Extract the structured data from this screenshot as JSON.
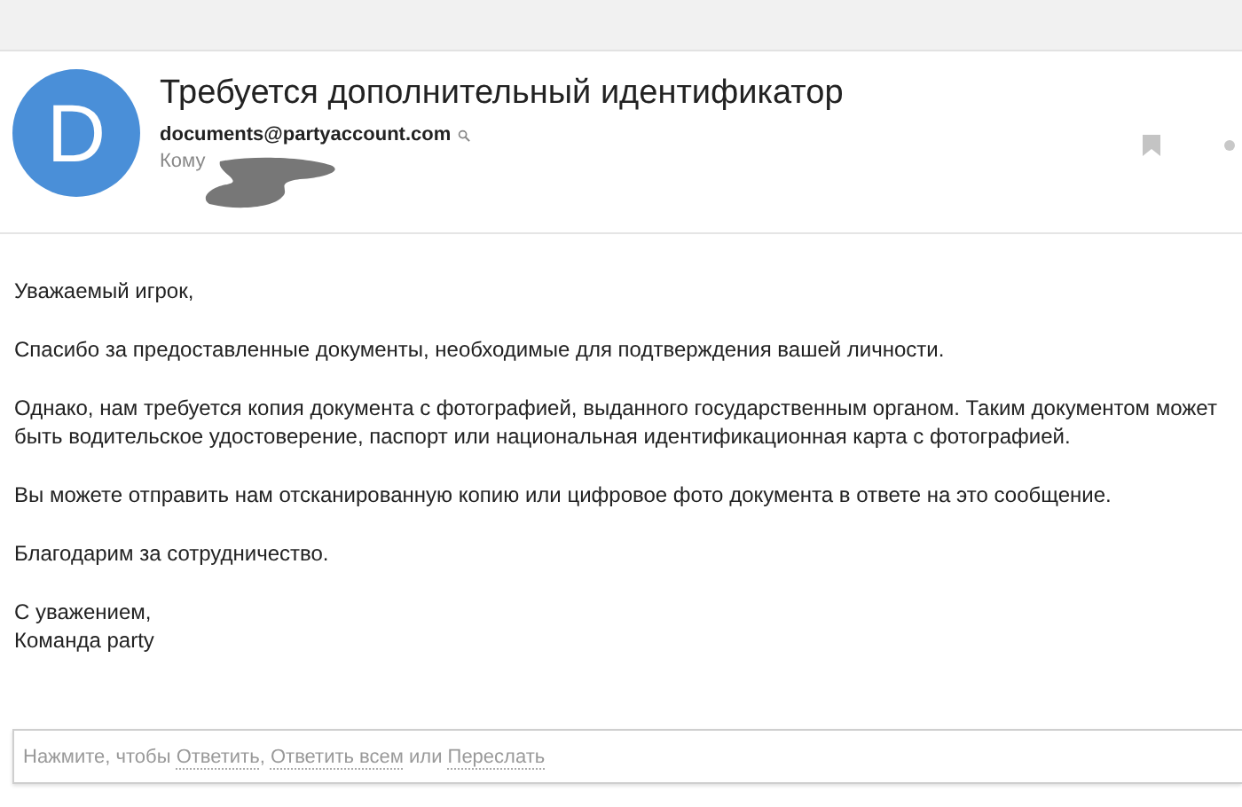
{
  "message": {
    "avatar_letter": "D",
    "subject": "Требуется дополнительный идентификатор",
    "sender": "documents@partyaccount.com",
    "to_label": "Кому"
  },
  "body": [
    "Уважаемый игрок,",
    "Спасибо за предоставленные документы, необходимые для подтверждения вашей личности.",
    "Однако, нам требуется копия документа с фотографией, выданного государственным органом. Таким документом может быть водительское удостоверение, паспорт или национальная идентификационная карта с фотографией.",
    "Вы можете отправить нам отсканированную копию или цифровое фото документа в ответе на это сообщение.",
    "Благодарим за сотрудничество."
  ],
  "signature": [
    "С уважением,",
    "Команда party"
  ],
  "reply": [
    {
      "kind": "text",
      "text": "Нажмите, чтобы "
    },
    {
      "kind": "link",
      "text": "Ответить"
    },
    {
      "kind": "text",
      "text": ", "
    },
    {
      "kind": "link",
      "text": "Ответить всем"
    },
    {
      "kind": "text",
      "text": " или "
    },
    {
      "kind": "link",
      "text": "Переслать"
    }
  ]
}
